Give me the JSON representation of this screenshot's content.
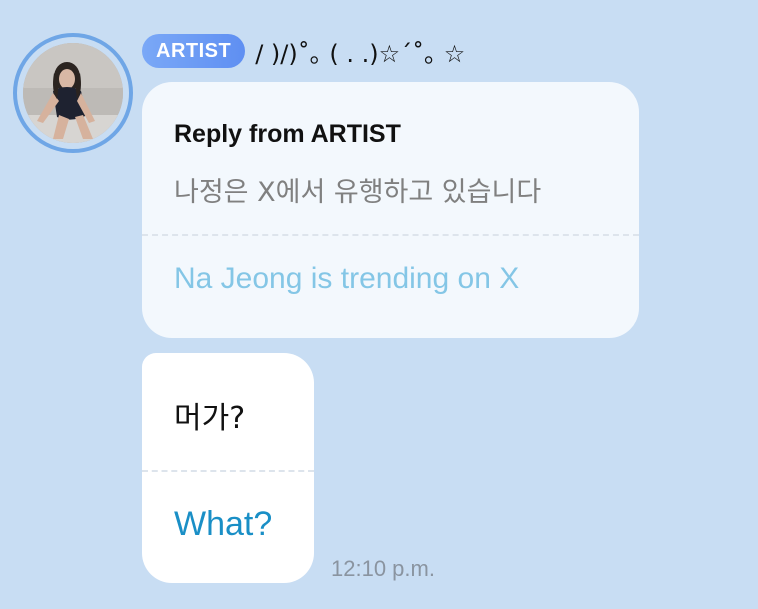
{
  "header": {
    "badge_label": "ARTIST",
    "artist_name": "/ )/)˚｡ ( . .)☆ˊ˚｡ ☆"
  },
  "reply": {
    "title": "Reply from ARTIST",
    "original_text": "나정은 X에서 유행하고 있습니다",
    "translation": "Na Jeong is trending on X"
  },
  "message": {
    "original_text": "머가?",
    "translation": "What?",
    "timestamp": "12:10 p.m."
  },
  "colors": {
    "background": "#c8ddf3",
    "badge": "#6f9cf5",
    "reply_translation": "#84c6e6",
    "message_translation": "#1a8fc6"
  }
}
